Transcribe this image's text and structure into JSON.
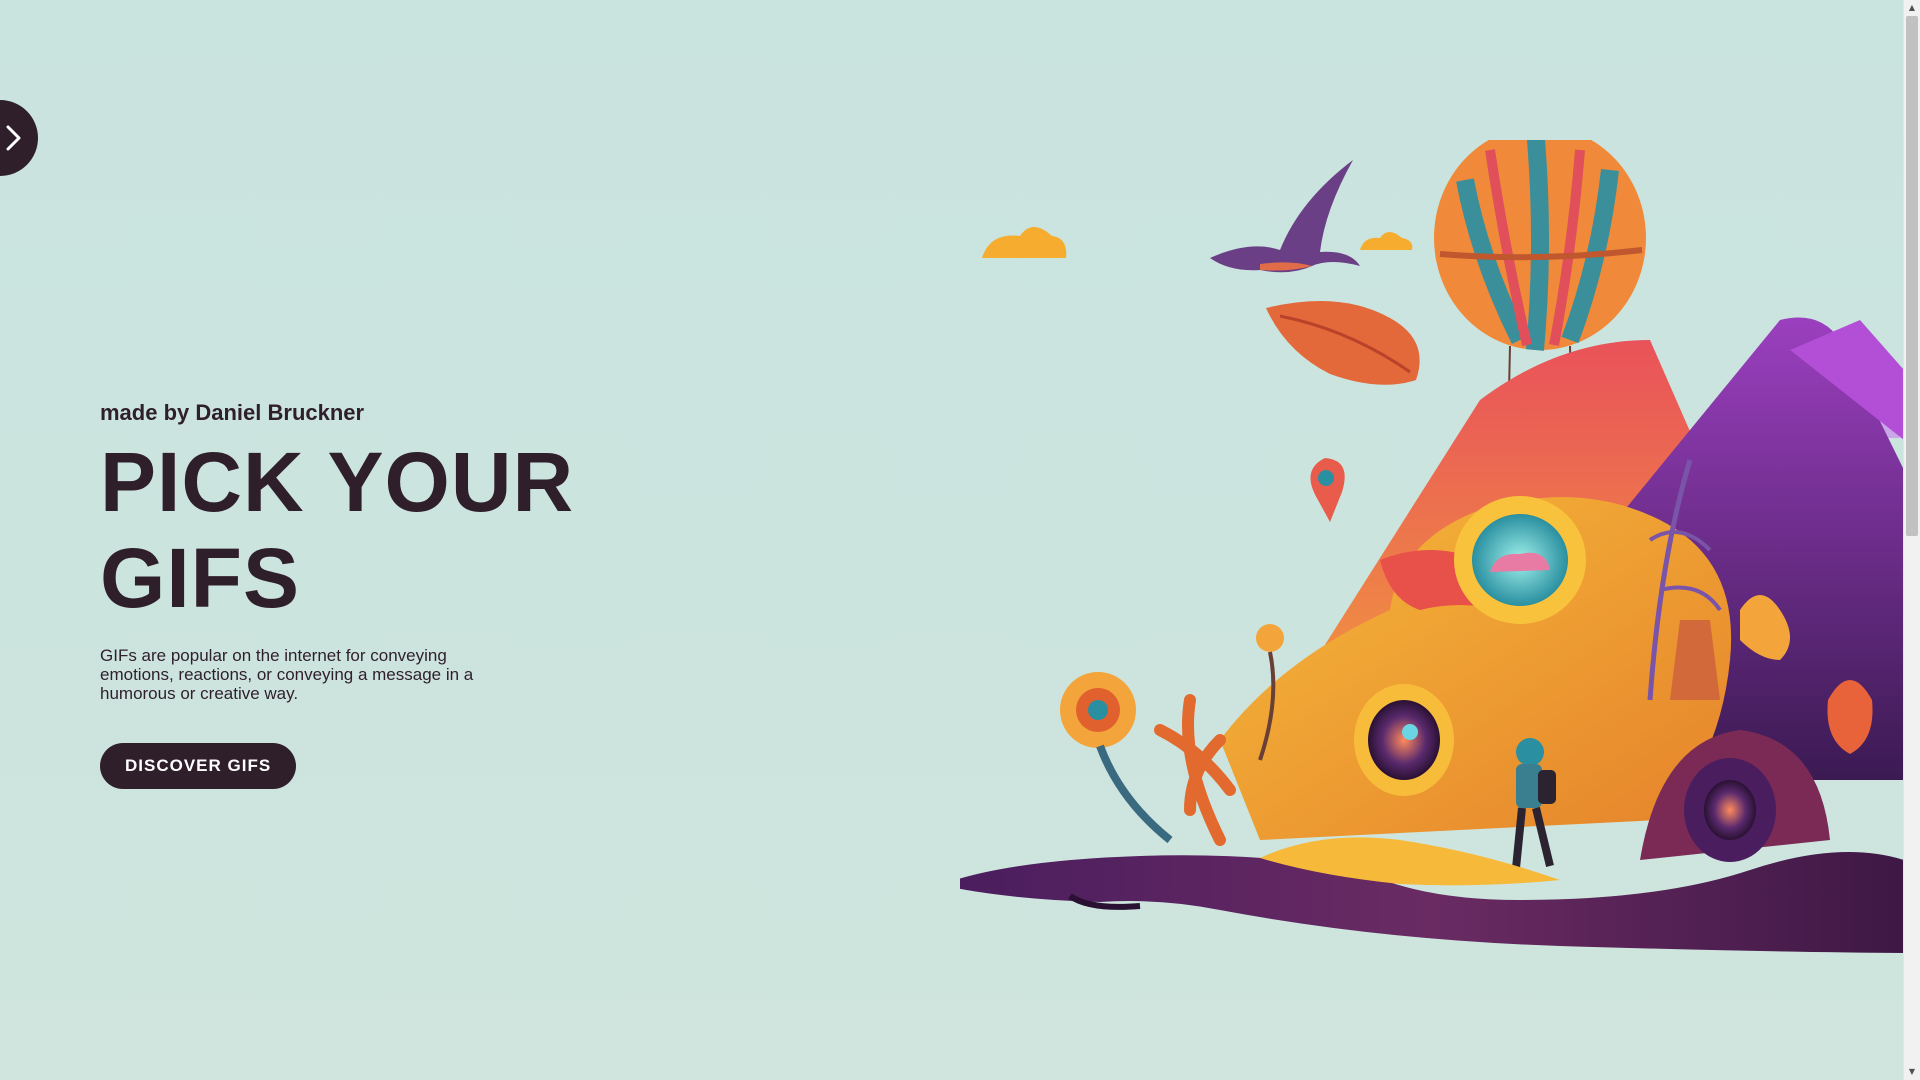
{
  "sidebar_toggle": {
    "icon": "chevron-right-icon"
  },
  "hero": {
    "byline": "made by Daniel Bruckner",
    "title_line1": "PICK YOUR",
    "title_line2": "GIFS",
    "description": "GIFs are popular on the internet for conveying emotions, reactions, or conveying a message in a humorous or creative way.",
    "cta_label": "DISCOVER GIFS"
  },
  "colors": {
    "background": "#c9e3df",
    "text": "#2f1f2a",
    "button_bg": "#2f1f2a",
    "button_text": "#ffffff"
  },
  "scrollbar": {
    "up_icon": "▲",
    "down_icon": "▼"
  }
}
